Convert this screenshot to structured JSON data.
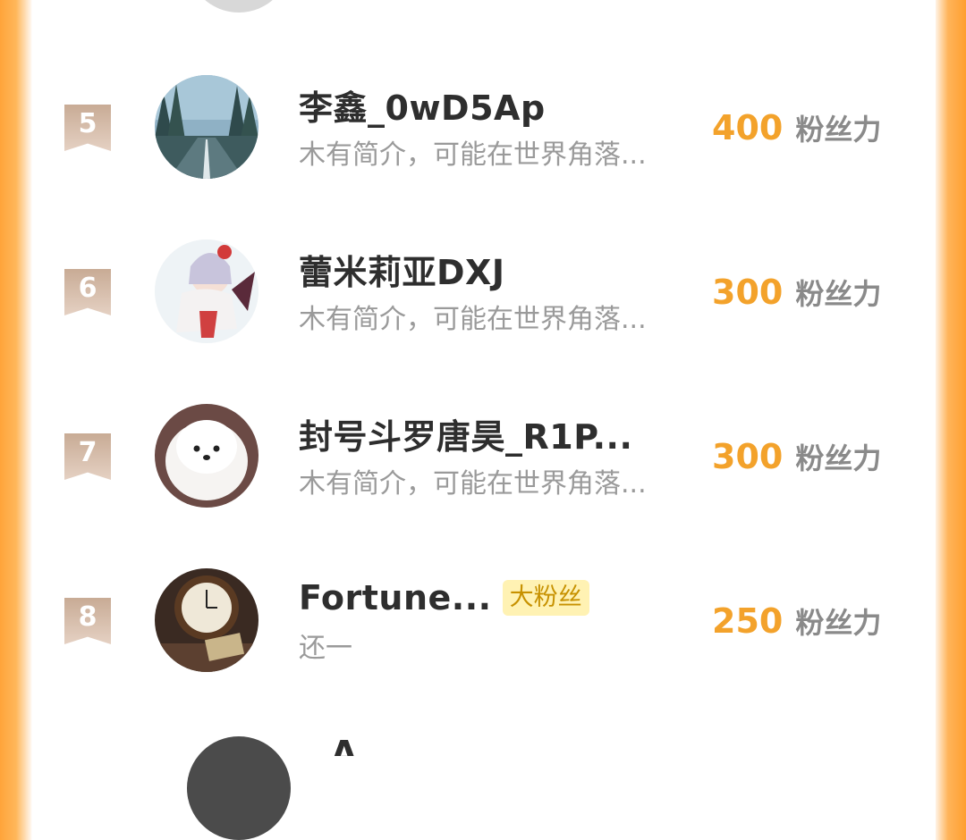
{
  "rows": [
    {
      "rank": "5",
      "name": "李鑫_0wD5Ap",
      "tag": "",
      "bio": "木有简介，可能在世界角落...",
      "score": "400",
      "unit": "粉丝力"
    },
    {
      "rank": "6",
      "name": "蕾米莉亚DXJ",
      "tag": "",
      "bio": "木有简介，可能在世界角落...",
      "score": "300",
      "unit": "粉丝力"
    },
    {
      "rank": "7",
      "name": "封号斗罗唐昊_R1P...",
      "tag": "",
      "bio": "木有简介，可能在世界角落...",
      "score": "300",
      "unit": "粉丝力"
    },
    {
      "rank": "8",
      "name": "Fortune...",
      "tag": "大粉丝",
      "bio": "还一",
      "score": "250",
      "unit": "粉丝力"
    }
  ],
  "partial_next": {
    "name": "A"
  },
  "colors": {
    "score": "#f3a22b",
    "badge": "#d2b8a4",
    "side": "#ffa43a"
  }
}
